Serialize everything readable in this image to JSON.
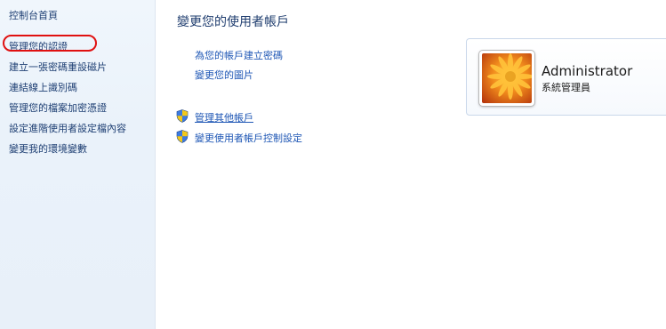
{
  "sidebar": {
    "home_label": "控制台首頁",
    "items": [
      {
        "label": "管理您的認證"
      },
      {
        "label": "建立一張密碼重設磁片"
      },
      {
        "label": "連結線上識別碼"
      },
      {
        "label": "管理您的檔案加密憑證"
      },
      {
        "label": "設定進階使用者設定檔內容"
      },
      {
        "label": "變更我的環境變數"
      }
    ]
  },
  "main": {
    "title": "變更您的使用者帳戶",
    "links": [
      {
        "label": "為您的帳戶建立密碼"
      },
      {
        "label": "變更您的圖片"
      }
    ],
    "admin_links": [
      {
        "label": "管理其他帳戶",
        "icon": "shield-icon"
      },
      {
        "label": "變更使用者帳戶控制設定",
        "icon": "shield-icon"
      }
    ]
  },
  "account": {
    "name": "Administrator",
    "role": "系統管理員",
    "avatar": "flower-picture"
  },
  "colors": {
    "sidebar_bg": "#eaf2fa",
    "link": "#1f57b5",
    "sidebar_link": "#1e3f73",
    "highlight": "#e01010"
  }
}
